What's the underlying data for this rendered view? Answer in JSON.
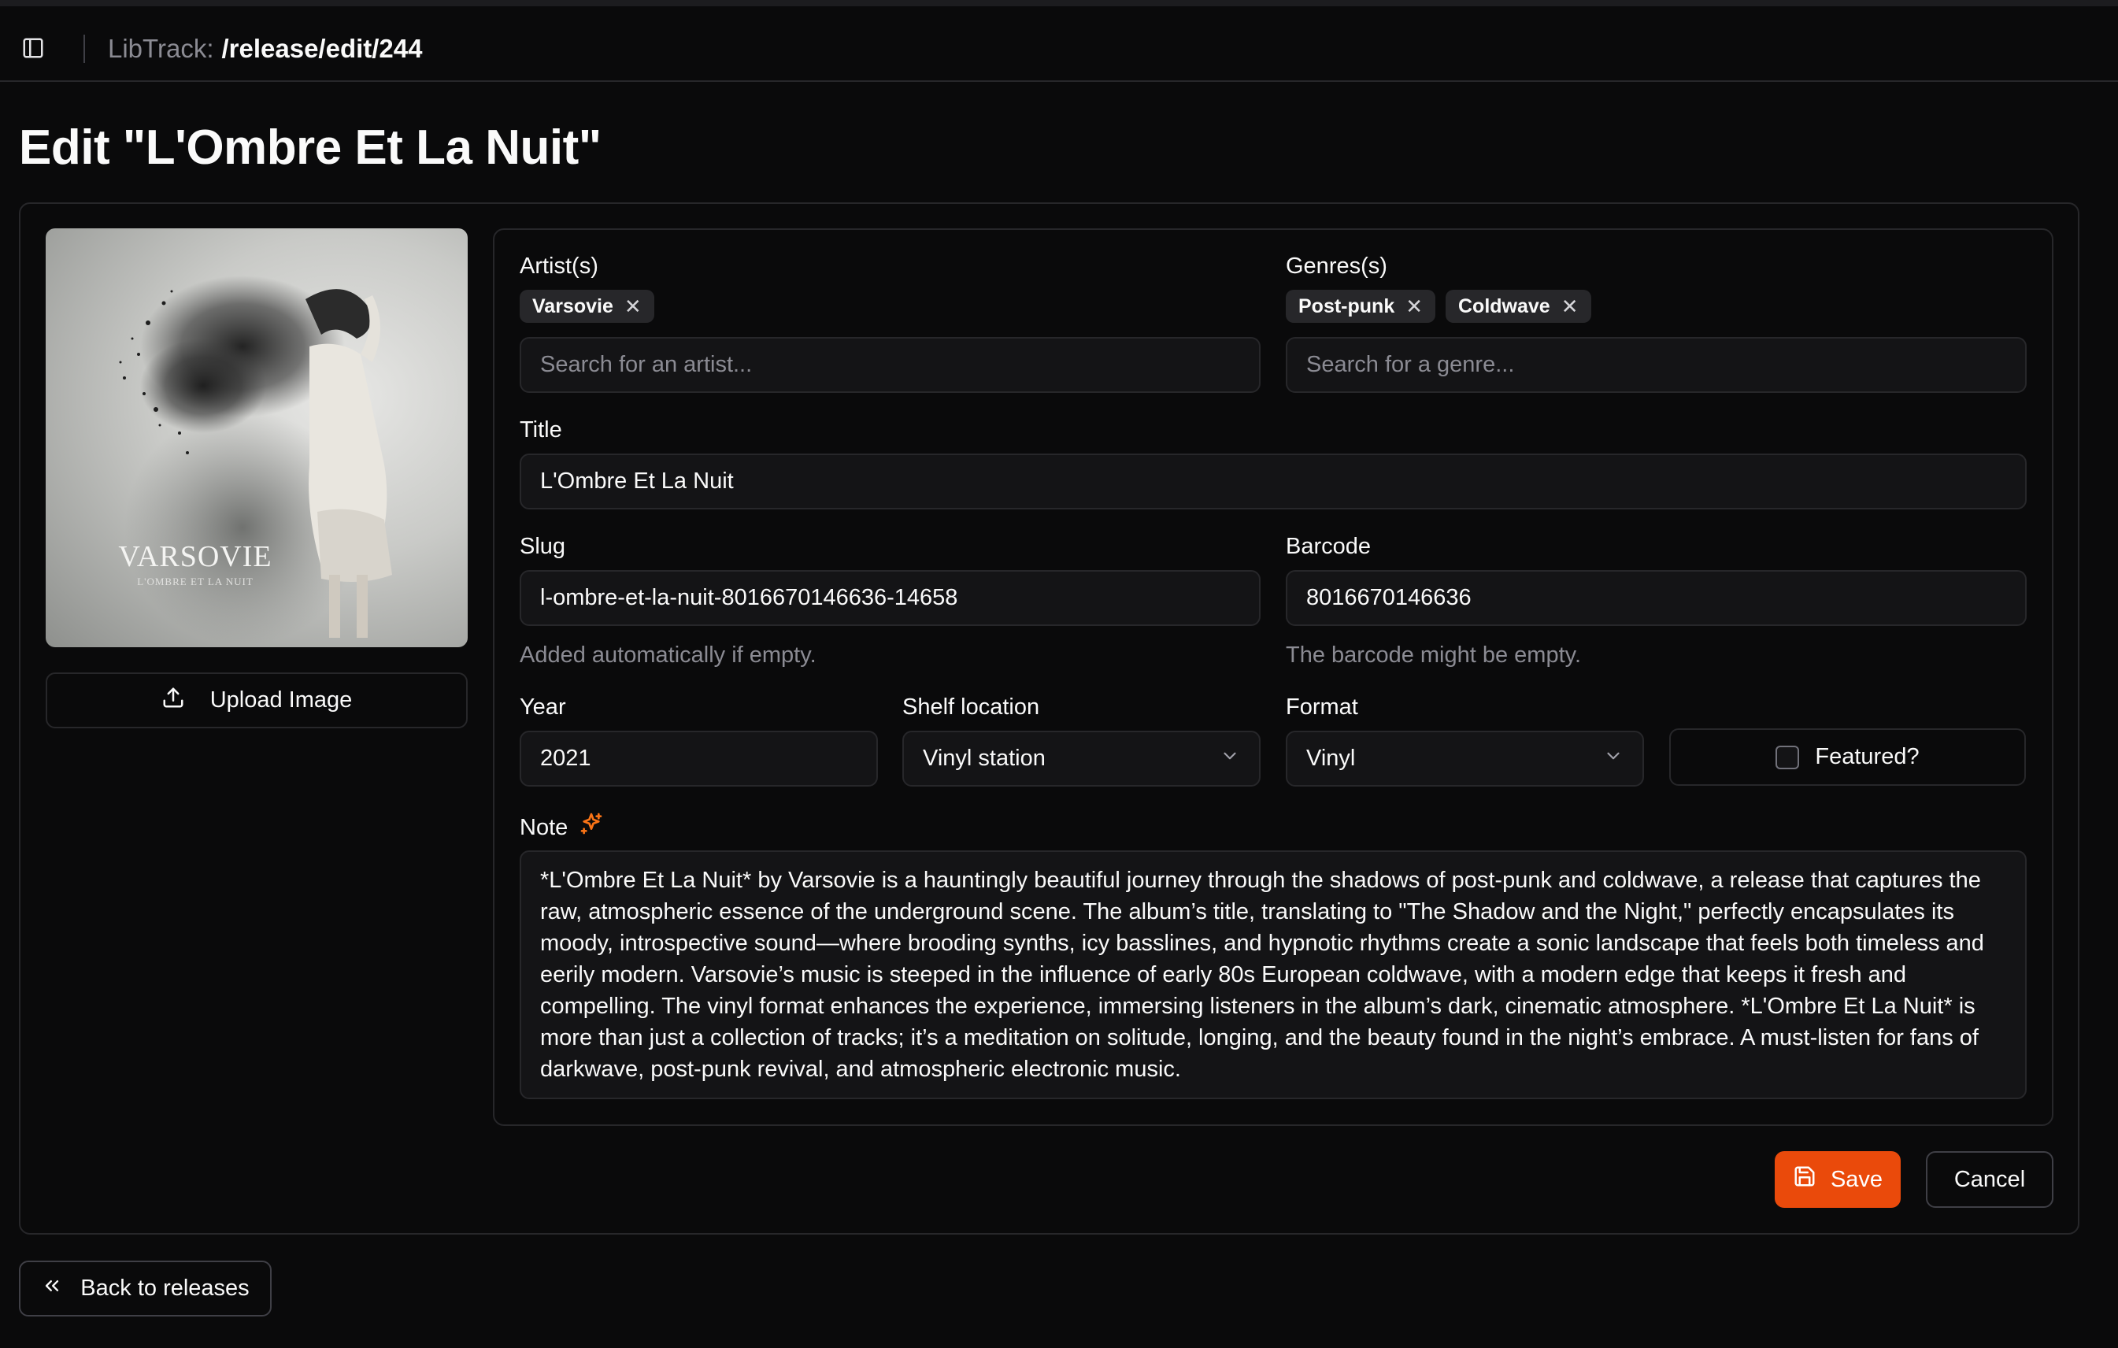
{
  "header": {
    "app_name": "LibTrack:",
    "path": "/release/edit/244"
  },
  "page": {
    "title": "Edit \"L'Ombre Et La Nuit\""
  },
  "cover": {
    "artist_text": "VARSOVIE",
    "album_text": "L'OMBRE ET LA NUIT",
    "upload_label": "Upload Image"
  },
  "form": {
    "artists": {
      "label": "Artist(s)",
      "chips": [
        "Varsovie"
      ],
      "placeholder": "Search for an artist..."
    },
    "genres": {
      "label": "Genres(s)",
      "chips": [
        "Post-punk",
        "Coldwave"
      ],
      "placeholder": "Search for a genre..."
    },
    "title": {
      "label": "Title",
      "value": "L'Ombre Et La Nuit"
    },
    "slug": {
      "label": "Slug",
      "value": "l-ombre-et-la-nuit-8016670146636-14658",
      "helper": "Added automatically if empty."
    },
    "barcode": {
      "label": "Barcode",
      "value": "8016670146636",
      "helper": "The barcode might be empty."
    },
    "year": {
      "label": "Year",
      "value": "2021"
    },
    "shelf_location": {
      "label": "Shelf location",
      "value": "Vinyl station"
    },
    "format": {
      "label": "Format",
      "value": "Vinyl"
    },
    "featured": {
      "label": "Featured?",
      "checked": false
    },
    "note": {
      "label": "Note",
      "value": "*L'Ombre Et La Nuit* by Varsovie is a hauntingly beautiful journey through the shadows of post-punk and coldwave, a release that captures the raw, atmospheric essence of the underground scene. The album’s title, translating to \"The Shadow and the Night,\" perfectly encapsulates its moody, introspective sound—where brooding synths, icy basslines, and hypnotic rhythms create a sonic landscape that feels both timeless and eerily modern. Varsovie’s music is steeped in the influence of early 80s European coldwave, with a modern edge that keeps it fresh and compelling. The vinyl format enhances the experience, immersing listeners in the album’s dark, cinematic atmosphere. *L'Ombre Et La Nuit* is more than just a collection of tracks; it’s a meditation on solitude, longing, and the beauty found in the night’s embrace. A must-listen for fans of darkwave, post-punk revival, and atmospheric electronic music."
    }
  },
  "actions": {
    "save_label": "Save",
    "cancel_label": "Cancel",
    "back_label": "Back to releases"
  },
  "icons": {
    "sidebar_toggle": "sidebar-toggle-icon",
    "upload": "upload-icon",
    "sparkle": "sparkles-icon",
    "save": "save-icon",
    "back": "chevrons-left-icon",
    "chevron": "chevron-down-icon",
    "remove": "x-icon"
  },
  "colors": {
    "background": "#0a0a0b",
    "accent": "#ea4a0b",
    "sparkle": "#f97316",
    "border": "#27272a",
    "muted_text": "#8b8b93"
  }
}
